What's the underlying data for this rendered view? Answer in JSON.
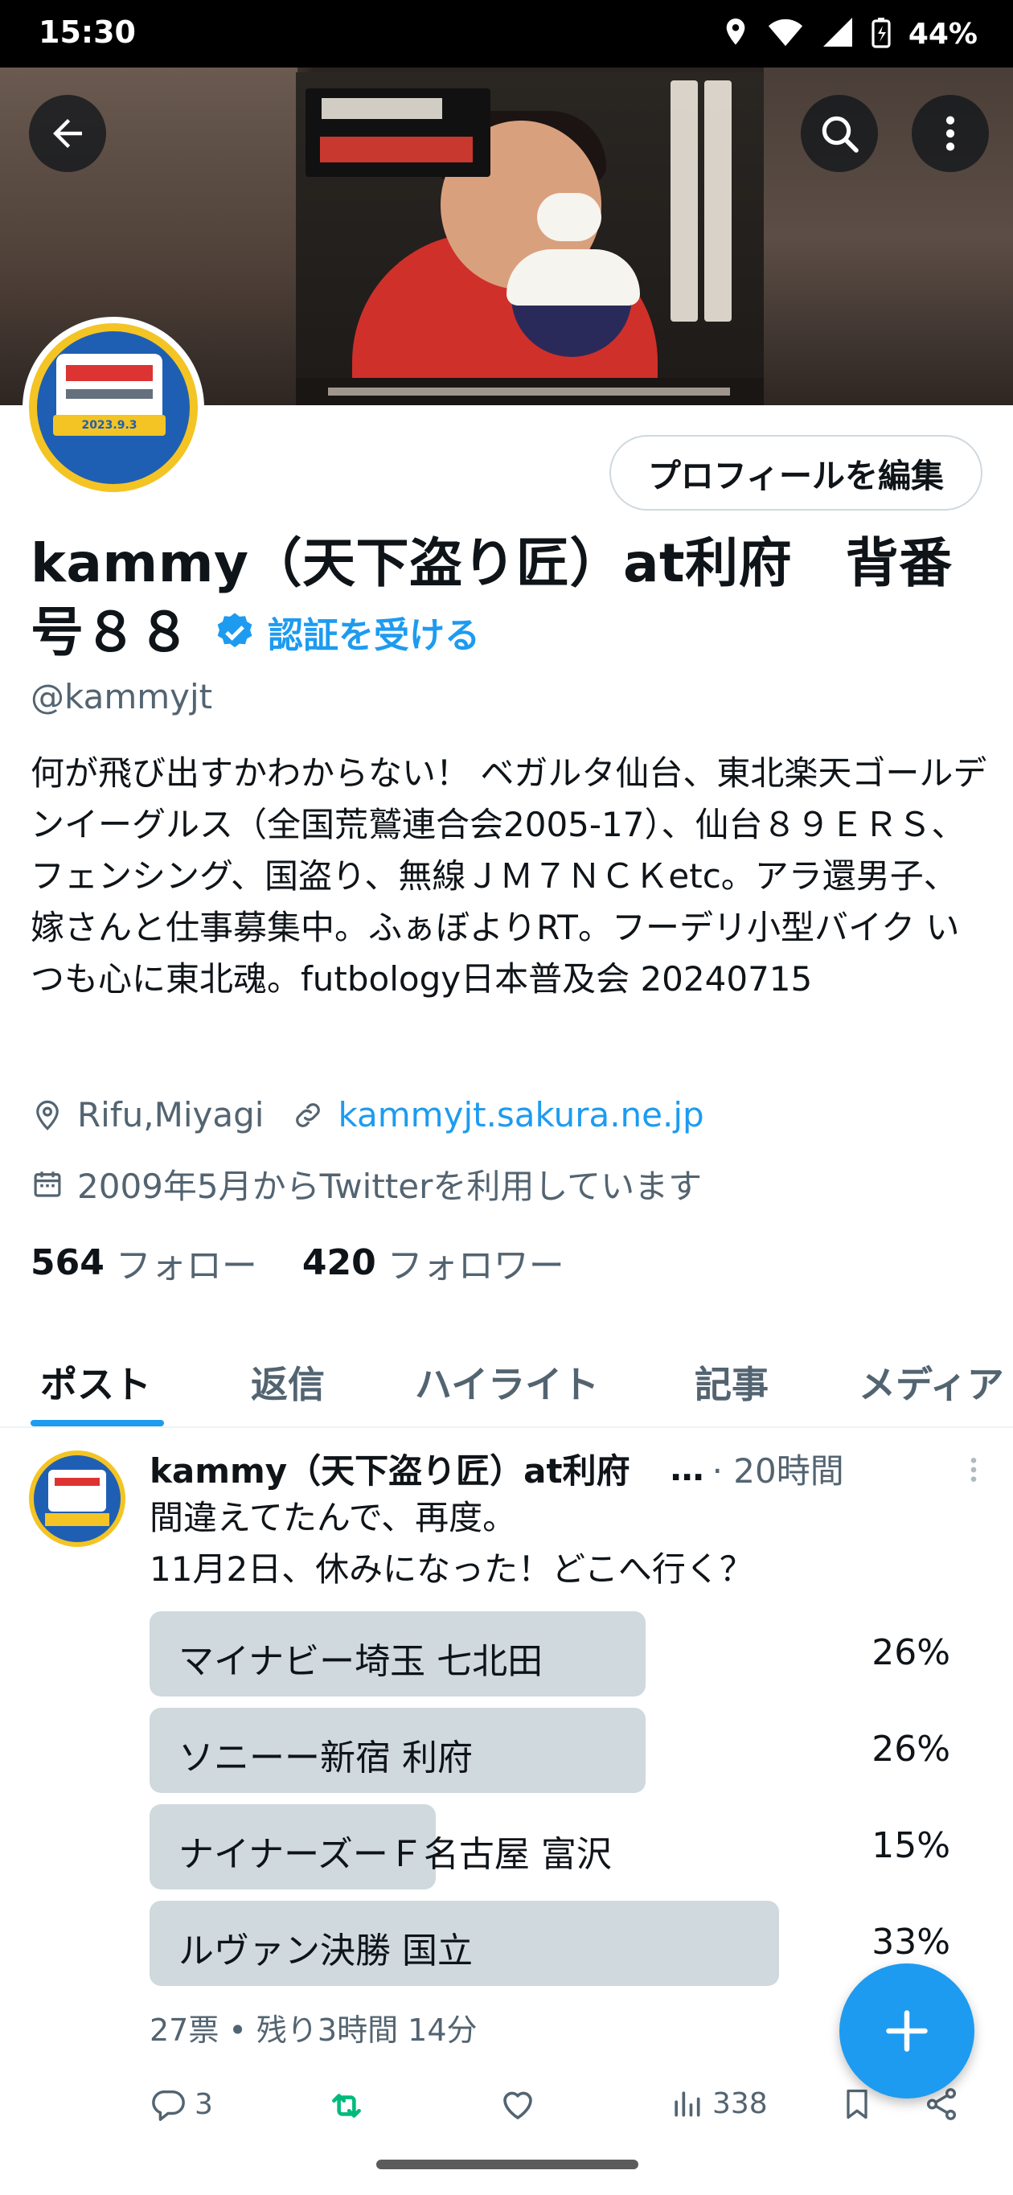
{
  "status_bar": {
    "time": "15:30",
    "battery": "44%",
    "icons": [
      "location-icon",
      "wifi-icon",
      "signal-icon",
      "battery-icon"
    ]
  },
  "header": {
    "back_icon": "arrow-left-icon",
    "search_icon": "search-icon",
    "more_icon": "more-vertical-icon"
  },
  "profile": {
    "edit_button": "プロフィールを編集",
    "display_name": "kammy（天下盗り匠）at利府　背番号８８",
    "verify_label": "認証を受ける",
    "handle": "@kammyjt",
    "bio": "何が飛び出すかわからない！ ベガルタ仙台、東北楽天ゴールデンイーグルス（全国荒鷲連合会2005-17）、仙台８９ＥＲＳ、フェンシング、国盗り、無線ＪＭ７ＮＣＫetc。アラ還男子、嫁さんと仕事募集中。ふぁぼよりRT。フーデリ小型バイク いつも心に東北魂。futbology日本普及会 20240715",
    "location": "Rifu,Miyagi",
    "website": "kammyjt.sakura.ne.jp",
    "joined": "2009年5月からTwitterを利用しています",
    "following_count": "564",
    "following_label": "フォロー",
    "followers_count": "420",
    "followers_label": "フォロワー",
    "avatar_badge": "2023.9.3"
  },
  "tabs": [
    {
      "label": "ポスト",
      "active": true
    },
    {
      "label": "返信",
      "active": false
    },
    {
      "label": "ハイライト",
      "active": false
    },
    {
      "label": "記事",
      "active": false
    },
    {
      "label": "メディア",
      "active": false
    }
  ],
  "post": {
    "author": "kammy（天下盗り匠）at利府",
    "ellipsis": "…",
    "time": "· 20時間",
    "text": "間違えてたんで、再度。\n11月2日、休みになった！どこへ行く？",
    "poll": [
      {
        "label": "マイナビー埼玉 七北田",
        "percent": "26%",
        "value": 26
      },
      {
        "label": "ソニーー新宿 利府",
        "percent": "26%",
        "value": 26
      },
      {
        "label": "ナイナーズーＦ名古屋 富沢",
        "percent": "15%",
        "value": 15
      },
      {
        "label": "ルヴァン決勝 国立",
        "percent": "33%",
        "value": 33
      }
    ],
    "poll_meta": "27票 • 残り3時間 14分",
    "replies": "3",
    "views": "338"
  },
  "colors": {
    "accent": "#1d9bf0",
    "retweet": "#00ba7c",
    "muted": "#536471",
    "poll_fill": "#cfd9de"
  }
}
